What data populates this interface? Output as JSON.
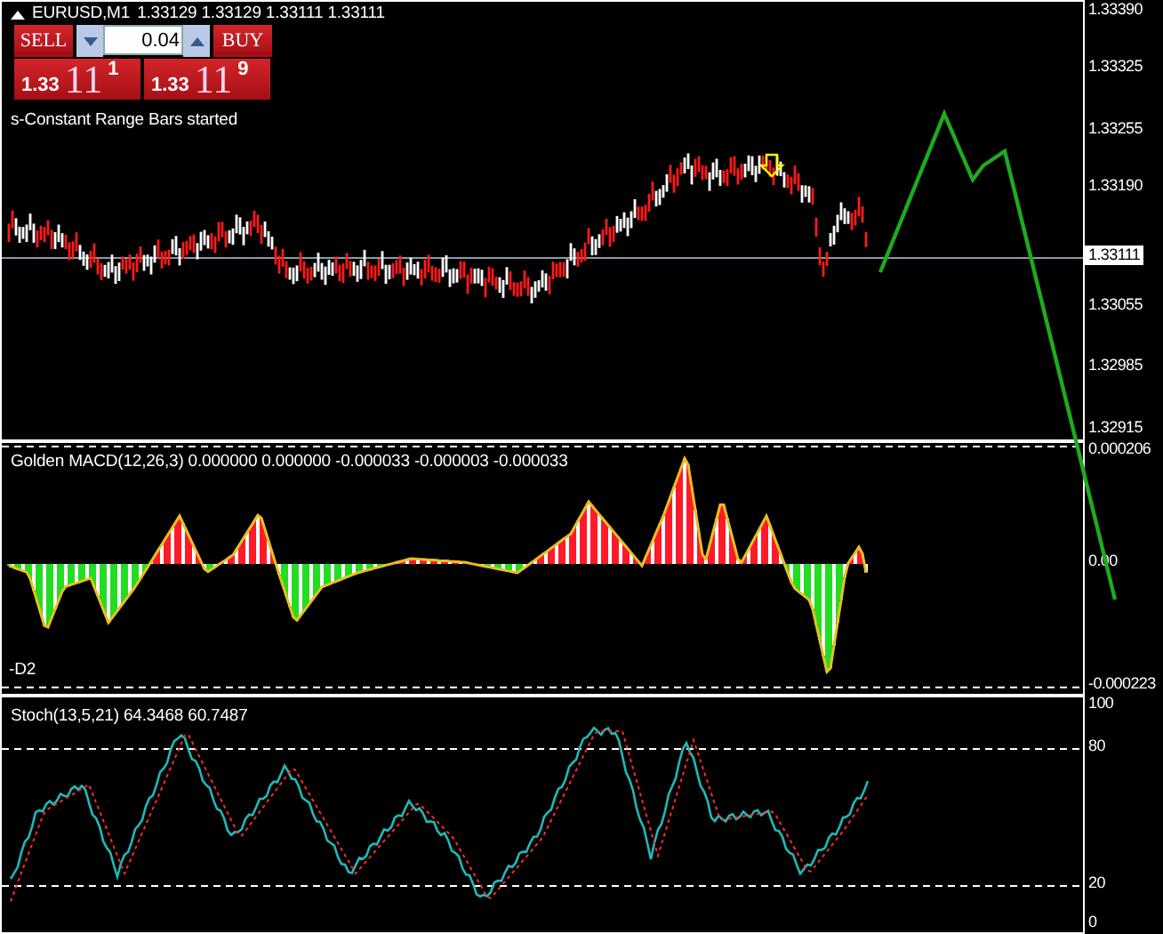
{
  "main_chart": {
    "symbol": "EURUSD,M1",
    "quotes": "1.33129 1.33129 1.33111 1.33111",
    "trade_panel": {
      "sell_label": "SELL",
      "buy_label": "BUY",
      "lot": "0.04",
      "sell_price": {
        "prefix": "1.33",
        "big": "11",
        "sup": "1"
      },
      "buy_price": {
        "prefix": "1.33",
        "big": "11",
        "sup": "9"
      }
    },
    "message": "s-Constant Range Bars started",
    "axis_labels": [
      "1.33390",
      "1.33325",
      "1.33255",
      "1.33190",
      "1.33055",
      "1.32985",
      "1.32915"
    ],
    "current_price": "1.33111"
  },
  "macd": {
    "title": "Golden MACD(12,26,3) 0.000000 0.000000 -0.000033 -0.000003 -0.000033",
    "level_label": "-D2",
    "axis_labels": [
      "0.000206",
      "0.00",
      "-0.000223"
    ]
  },
  "stoch": {
    "title": "Stoch(13,5,21) 64.3468 60.7487",
    "axis_labels": [
      "100",
      "80",
      "20",
      "0"
    ]
  }
}
